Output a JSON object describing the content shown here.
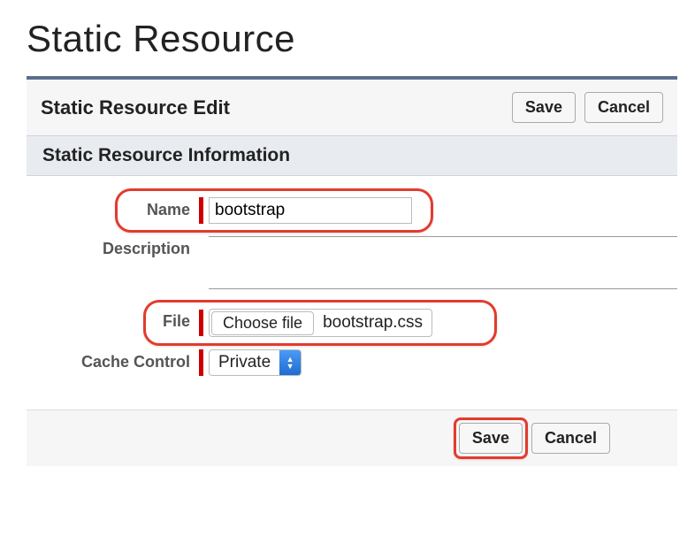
{
  "page": {
    "title": "Static Resource"
  },
  "panel": {
    "edit_title": "Static Resource Edit",
    "section_title": "Static Resource Information"
  },
  "buttons": {
    "save": "Save",
    "cancel": "Cancel"
  },
  "labels": {
    "name": "Name",
    "description": "Description",
    "file": "File",
    "cache_control": "Cache Control",
    "choose_file": "Choose file"
  },
  "values": {
    "name": "bootstrap",
    "description": "",
    "file_name": "bootstrap.css",
    "cache_control": "Private"
  }
}
